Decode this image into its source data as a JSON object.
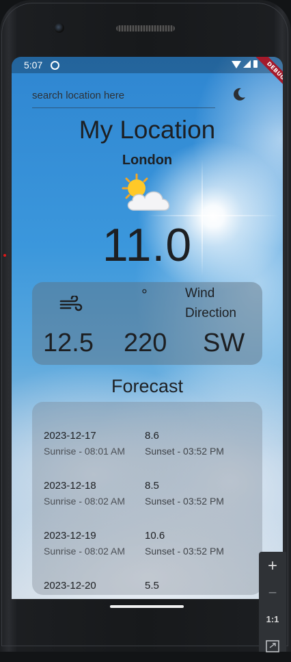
{
  "status_bar": {
    "time": "5:07"
  },
  "debug_banner": "DEBUG",
  "search": {
    "placeholder": "search location here",
    "value": ""
  },
  "header": {
    "title": "My Location",
    "city": "London"
  },
  "current": {
    "temperature": "11.0",
    "weather_icon": "sun-behind-cloud-icon"
  },
  "wind": {
    "degree_symbol": "°",
    "direction_label": "Wind Direction",
    "speed": "12.5",
    "degrees": "220",
    "direction": "SW"
  },
  "forecast": {
    "title": "Forecast",
    "days": [
      {
        "date": "2023-12-17",
        "temp": "8.6",
        "sunrise": "Sunrise - 08:01 AM",
        "sunset": "Sunset - 03:52 PM"
      },
      {
        "date": "2023-12-18",
        "temp": "8.5",
        "sunrise": "Sunrise - 08:02 AM",
        "sunset": "Sunset - 03:52 PM"
      },
      {
        "date": "2023-12-19",
        "temp": "10.6",
        "sunrise": "Sunrise - 08:02 AM",
        "sunset": "Sunset - 03:52 PM"
      },
      {
        "date": "2023-12-20",
        "temp": "5.5",
        "sunrise": "",
        "sunset": ""
      }
    ]
  },
  "zoom_controls": {
    "zoom_in": "+",
    "zoom_out": "−",
    "one_to_one": "1:1"
  }
}
